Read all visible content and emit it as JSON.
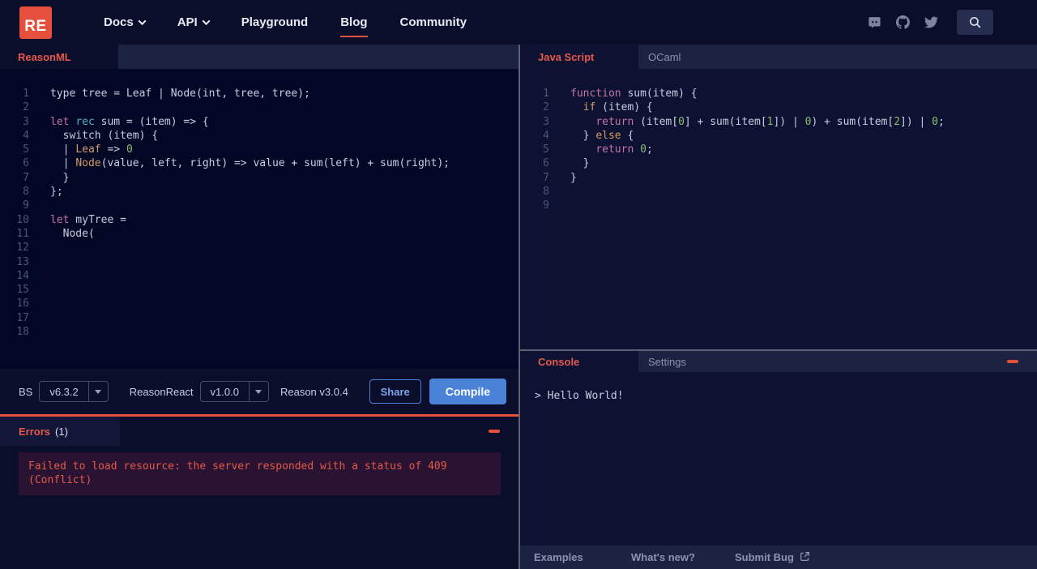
{
  "colors": {
    "accent": "#e4503c",
    "tab_red": "#e6584a",
    "blue": "#4a82d8",
    "error_text": "#e25b47",
    "error_bg": "#2a1233",
    "keyword_pink": "#c972a4",
    "cyan": "#58b0c6",
    "orange": "#d49a66",
    "number_green": "#89bd6e"
  },
  "navbar": {
    "logo": "RE",
    "items": [
      {
        "label": "Docs",
        "caret": true,
        "active": false
      },
      {
        "label": "API",
        "caret": true,
        "active": false
      },
      {
        "label": "Playground",
        "caret": false,
        "active": false
      },
      {
        "label": "Blog",
        "caret": false,
        "active": true
      },
      {
        "label": "Community",
        "caret": false,
        "active": false
      }
    ],
    "icons": [
      "discord-icon",
      "github-icon",
      "twitter-icon",
      "search-icon"
    ]
  },
  "left": {
    "tab": "ReasonML",
    "editor_lines": [
      [
        [
          "type tree = Leaf | Node(int, tree, tree);",
          "d"
        ]
      ],
      [],
      [
        [
          "let",
          "k"
        ],
        [
          " ",
          "d"
        ],
        [
          "rec",
          "c"
        ],
        [
          " sum = (item) => {",
          "d"
        ]
      ],
      [
        [
          "  switch (item) {",
          "d"
        ]
      ],
      [
        [
          "  | ",
          "d"
        ],
        [
          "Leaf",
          "o"
        ],
        [
          " => ",
          "d"
        ],
        [
          "0",
          "n"
        ]
      ],
      [
        [
          "  | ",
          "d"
        ],
        [
          "Node",
          "o"
        ],
        [
          "(value, left, right) => value + sum(left) + sum(right);",
          "d"
        ]
      ],
      [
        [
          "  }",
          "d"
        ]
      ],
      [
        [
          "};",
          "d"
        ]
      ],
      [],
      [
        [
          "let",
          "k"
        ],
        [
          " myTree =",
          "d"
        ]
      ],
      [
        [
          "  Node(",
          "d"
        ]
      ],
      [],
      [],
      [],
      [],
      [],
      [],
      []
    ],
    "toolbar": {
      "bs_label": "BS",
      "bs_version": "v6.3.2",
      "reasonreact_label": "ReasonReact",
      "reasonreact_version": "v1.0.0",
      "reason_version": "Reason v3.0.4",
      "share_label": "Share",
      "compile_label": "Compile"
    },
    "errors": {
      "title": "Errors",
      "count": "(1)",
      "message_line1": "Failed to load resource: the server responded with a status of 409",
      "message_line2": "(Conflict)"
    }
  },
  "right": {
    "tabs": [
      {
        "label": "Java Script",
        "active": true
      },
      {
        "label": "OCaml",
        "active": false
      }
    ],
    "editor_lines": [
      [
        [
          "function",
          "k"
        ],
        [
          " sum(item) {",
          "d"
        ]
      ],
      [
        [
          "  ",
          "d"
        ],
        [
          "if",
          "o"
        ],
        [
          " (item) {",
          "d"
        ]
      ],
      [
        [
          "    ",
          "d"
        ],
        [
          "return",
          "k"
        ],
        [
          " (item[",
          "d"
        ],
        [
          "0",
          "n"
        ],
        [
          "] + sum(item[",
          "d"
        ],
        [
          "1",
          "n"
        ],
        [
          "]) | ",
          "d"
        ],
        [
          "0",
          "n"
        ],
        [
          ") + sum(item[",
          "d"
        ],
        [
          "2",
          "n"
        ],
        [
          "]) | ",
          "d"
        ],
        [
          "0",
          "n"
        ],
        [
          ";",
          "d"
        ]
      ],
      [
        [
          "  } ",
          "d"
        ],
        [
          "else",
          "o"
        ],
        [
          " {",
          "d"
        ]
      ],
      [
        [
          "    ",
          "d"
        ],
        [
          "return",
          "k"
        ],
        [
          " ",
          "d"
        ],
        [
          "0",
          "n"
        ],
        [
          ";",
          "d"
        ]
      ],
      [
        [
          "  }",
          "d"
        ]
      ],
      [
        [
          "}",
          "d"
        ]
      ],
      [],
      []
    ],
    "console": {
      "tabs": [
        {
          "label": "Console",
          "active": true
        },
        {
          "label": "Settings",
          "active": false
        }
      ],
      "output": "> Hello World!"
    },
    "footer": [
      "Examples",
      "What's new?",
      "Submit Bug"
    ]
  }
}
